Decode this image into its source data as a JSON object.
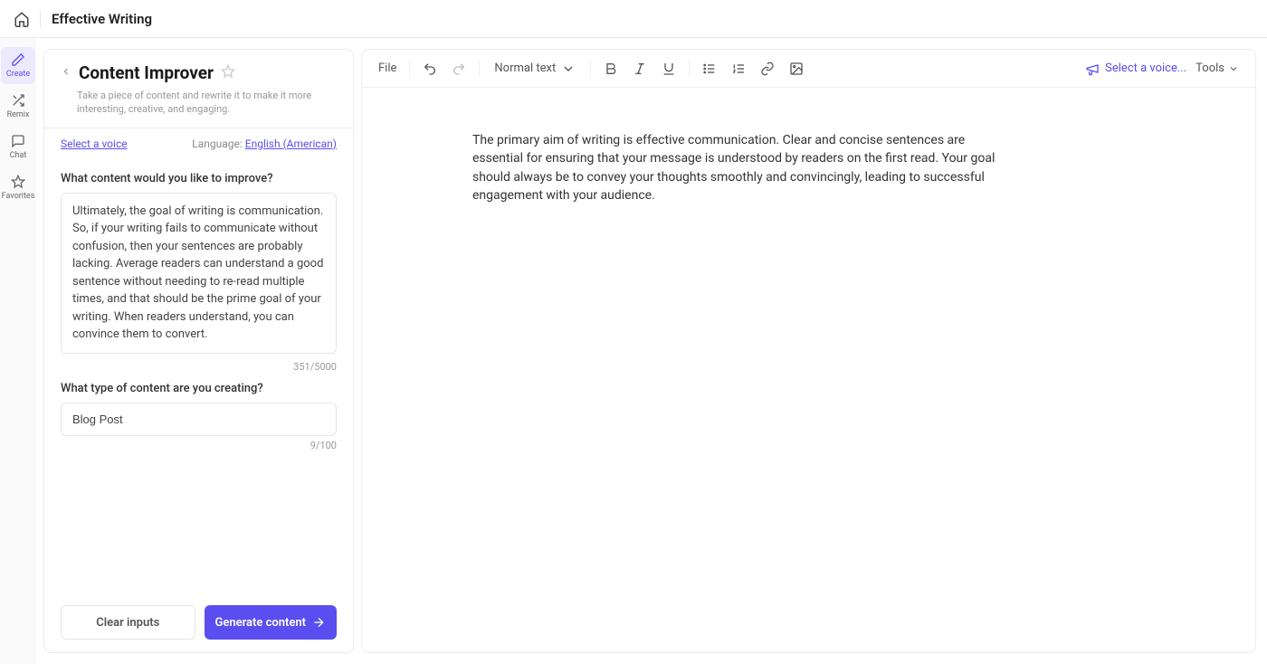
{
  "header": {
    "title": "Effective Writing"
  },
  "rail": {
    "items": [
      {
        "label": "Create"
      },
      {
        "label": "Remix"
      },
      {
        "label": "Chat"
      },
      {
        "label": "Favorites"
      }
    ]
  },
  "panel": {
    "title": "Content Improver",
    "description": "Take a piece of content and rewrite it to make it more interesting, creative, and engaging.",
    "select_voice": "Select a voice",
    "language_label": "Language:",
    "language_value": "English (American)",
    "field1_label": "What content would you like to improve?",
    "field1_value": "Ultimately, the goal of writing is communication. So, if your writing fails to communicate without confusion, then your sentences are probably lacking. Average readers can understand a good sentence without needing to re-read multiple times, and that should be the prime goal of your writing. When readers understand, you can convince them to convert.",
    "field1_count": "351/5000",
    "field2_label": "What type of content are you creating?",
    "field2_value": "Blog Post",
    "field2_count": "9/100",
    "clear_label": "Clear inputs",
    "generate_label": "Generate content"
  },
  "toolbar": {
    "file": "File",
    "style": "Normal text",
    "voice": "Select a voice...",
    "tools": "Tools"
  },
  "document": {
    "content": "The primary aim of writing is effective communication. Clear and concise sentences are essential for ensuring that your message is understood by readers on the first read. Your goal should always be to convey your thoughts smoothly and convincingly, leading to successful engagement with your audience."
  }
}
